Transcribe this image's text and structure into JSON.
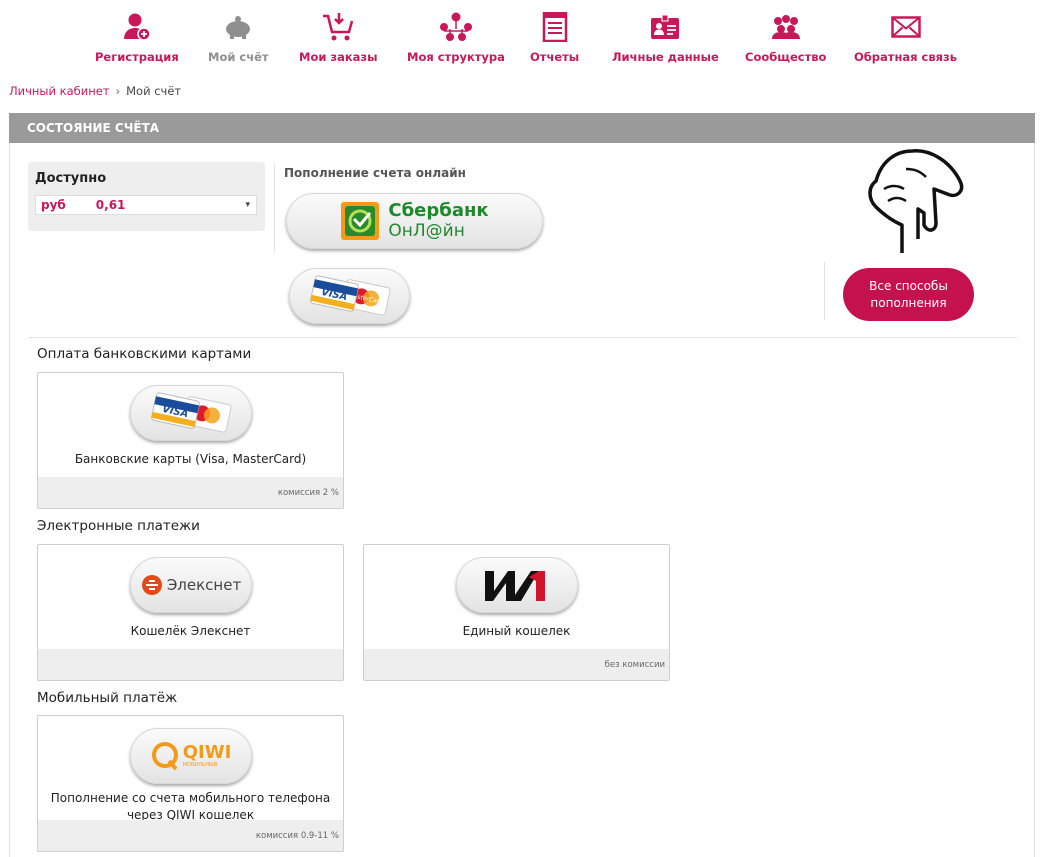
{
  "nav": [
    {
      "label": "Регистрация",
      "icon": "user-add-icon",
      "active": false
    },
    {
      "label": "Мой счёт",
      "icon": "piggy-bank-icon",
      "active": true
    },
    {
      "label": "Мои заказы",
      "icon": "cart-icon",
      "active": false
    },
    {
      "label": "Моя структура",
      "icon": "structure-icon",
      "active": false
    },
    {
      "label": "Отчеты",
      "icon": "report-icon",
      "active": false
    },
    {
      "label": "Личные данные",
      "icon": "id-card-icon",
      "active": false
    },
    {
      "label": "Сообщество",
      "icon": "community-icon",
      "active": false
    },
    {
      "label": "Обратная связь",
      "icon": "envelope-icon",
      "active": false
    }
  ],
  "breadcrumb": {
    "home": "Личный кабинет",
    "sep": "›",
    "current": "Мой счёт"
  },
  "section_title": "СОСТОЯНИЕ СЧЁТА",
  "balance": {
    "title": "Доступно",
    "currency": "руб",
    "amount": "0,61",
    "arrow": "▾"
  },
  "online": {
    "title": "Пополнение счета онлайн",
    "sber_line1": "Сбербанк",
    "sber_line2": "ОнЛ@йн",
    "visa": "VISA",
    "mastercard": "MasterCard"
  },
  "all_methods_button": "Все способы пополнения",
  "categories": [
    {
      "title": "Оплата банковскими картами",
      "items": [
        {
          "caption": "Банковские карты (Visa, MasterCard)",
          "fee": "комиссия 2 %",
          "logo": "VISA"
        }
      ]
    },
    {
      "title": "Электронные платежи",
      "items": [
        {
          "caption": "Кошелёк Элекснет",
          "fee": "",
          "logo": "Элекснет"
        },
        {
          "caption": "Единый кошелек",
          "fee": "без комиссии",
          "logo": "W1"
        }
      ]
    },
    {
      "title": "Мобильный платёж",
      "items": [
        {
          "caption": "Пополнение со счета мобильного телефона через QIWI кошелек",
          "fee": "комиссия 0.9-11 %",
          "logo": "QIWI",
          "logo_sub": "МОБИЛЬНЫЙ"
        }
      ]
    }
  ],
  "colors": {
    "brand": "#c8185a",
    "button": "#c5124f",
    "header_bar": "#9a9a9a",
    "inactive_nav": "#8f8f8f"
  }
}
